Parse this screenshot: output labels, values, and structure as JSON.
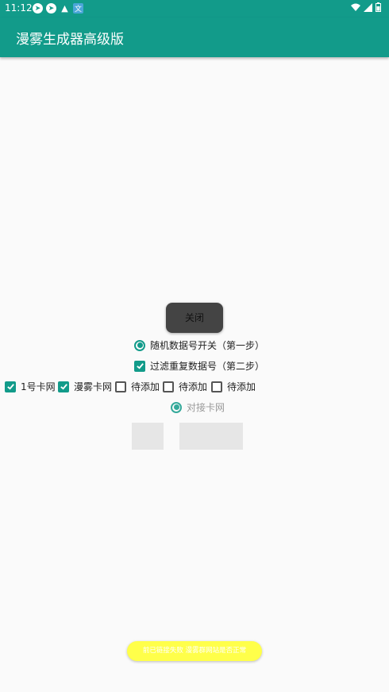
{
  "status_bar": {
    "time": "11:12",
    "icons": [
      "telegram-icon",
      "telegram-icon",
      "cat-icon",
      "translate-icon"
    ],
    "right_icons": [
      "wifi-icon",
      "signal-icon",
      "battery-icon"
    ]
  },
  "app": {
    "title": "漫雾生成器高级版",
    "accent_color": "#129b8a"
  },
  "close_button": {
    "label": "关闭"
  },
  "radio_random": {
    "label": "随机数据号开关（第一步）",
    "checked": true
  },
  "checkbox_filter": {
    "label": "过滤重复数据号（第二步）",
    "checked": true
  },
  "checkbox_row": [
    {
      "label": "1号卡网",
      "checked": true
    },
    {
      "label": "漫雾卡网",
      "checked": true
    },
    {
      "label": "待添加",
      "checked": false
    },
    {
      "label": "待添加",
      "checked": false
    },
    {
      "label": "待添加",
      "checked": false
    }
  ],
  "radio_dock": {
    "label": "对接卡网",
    "checked": true
  },
  "toast": {
    "text": "前已链接失败 漫雾群网站是否正常",
    "color": "#ffff4a"
  }
}
